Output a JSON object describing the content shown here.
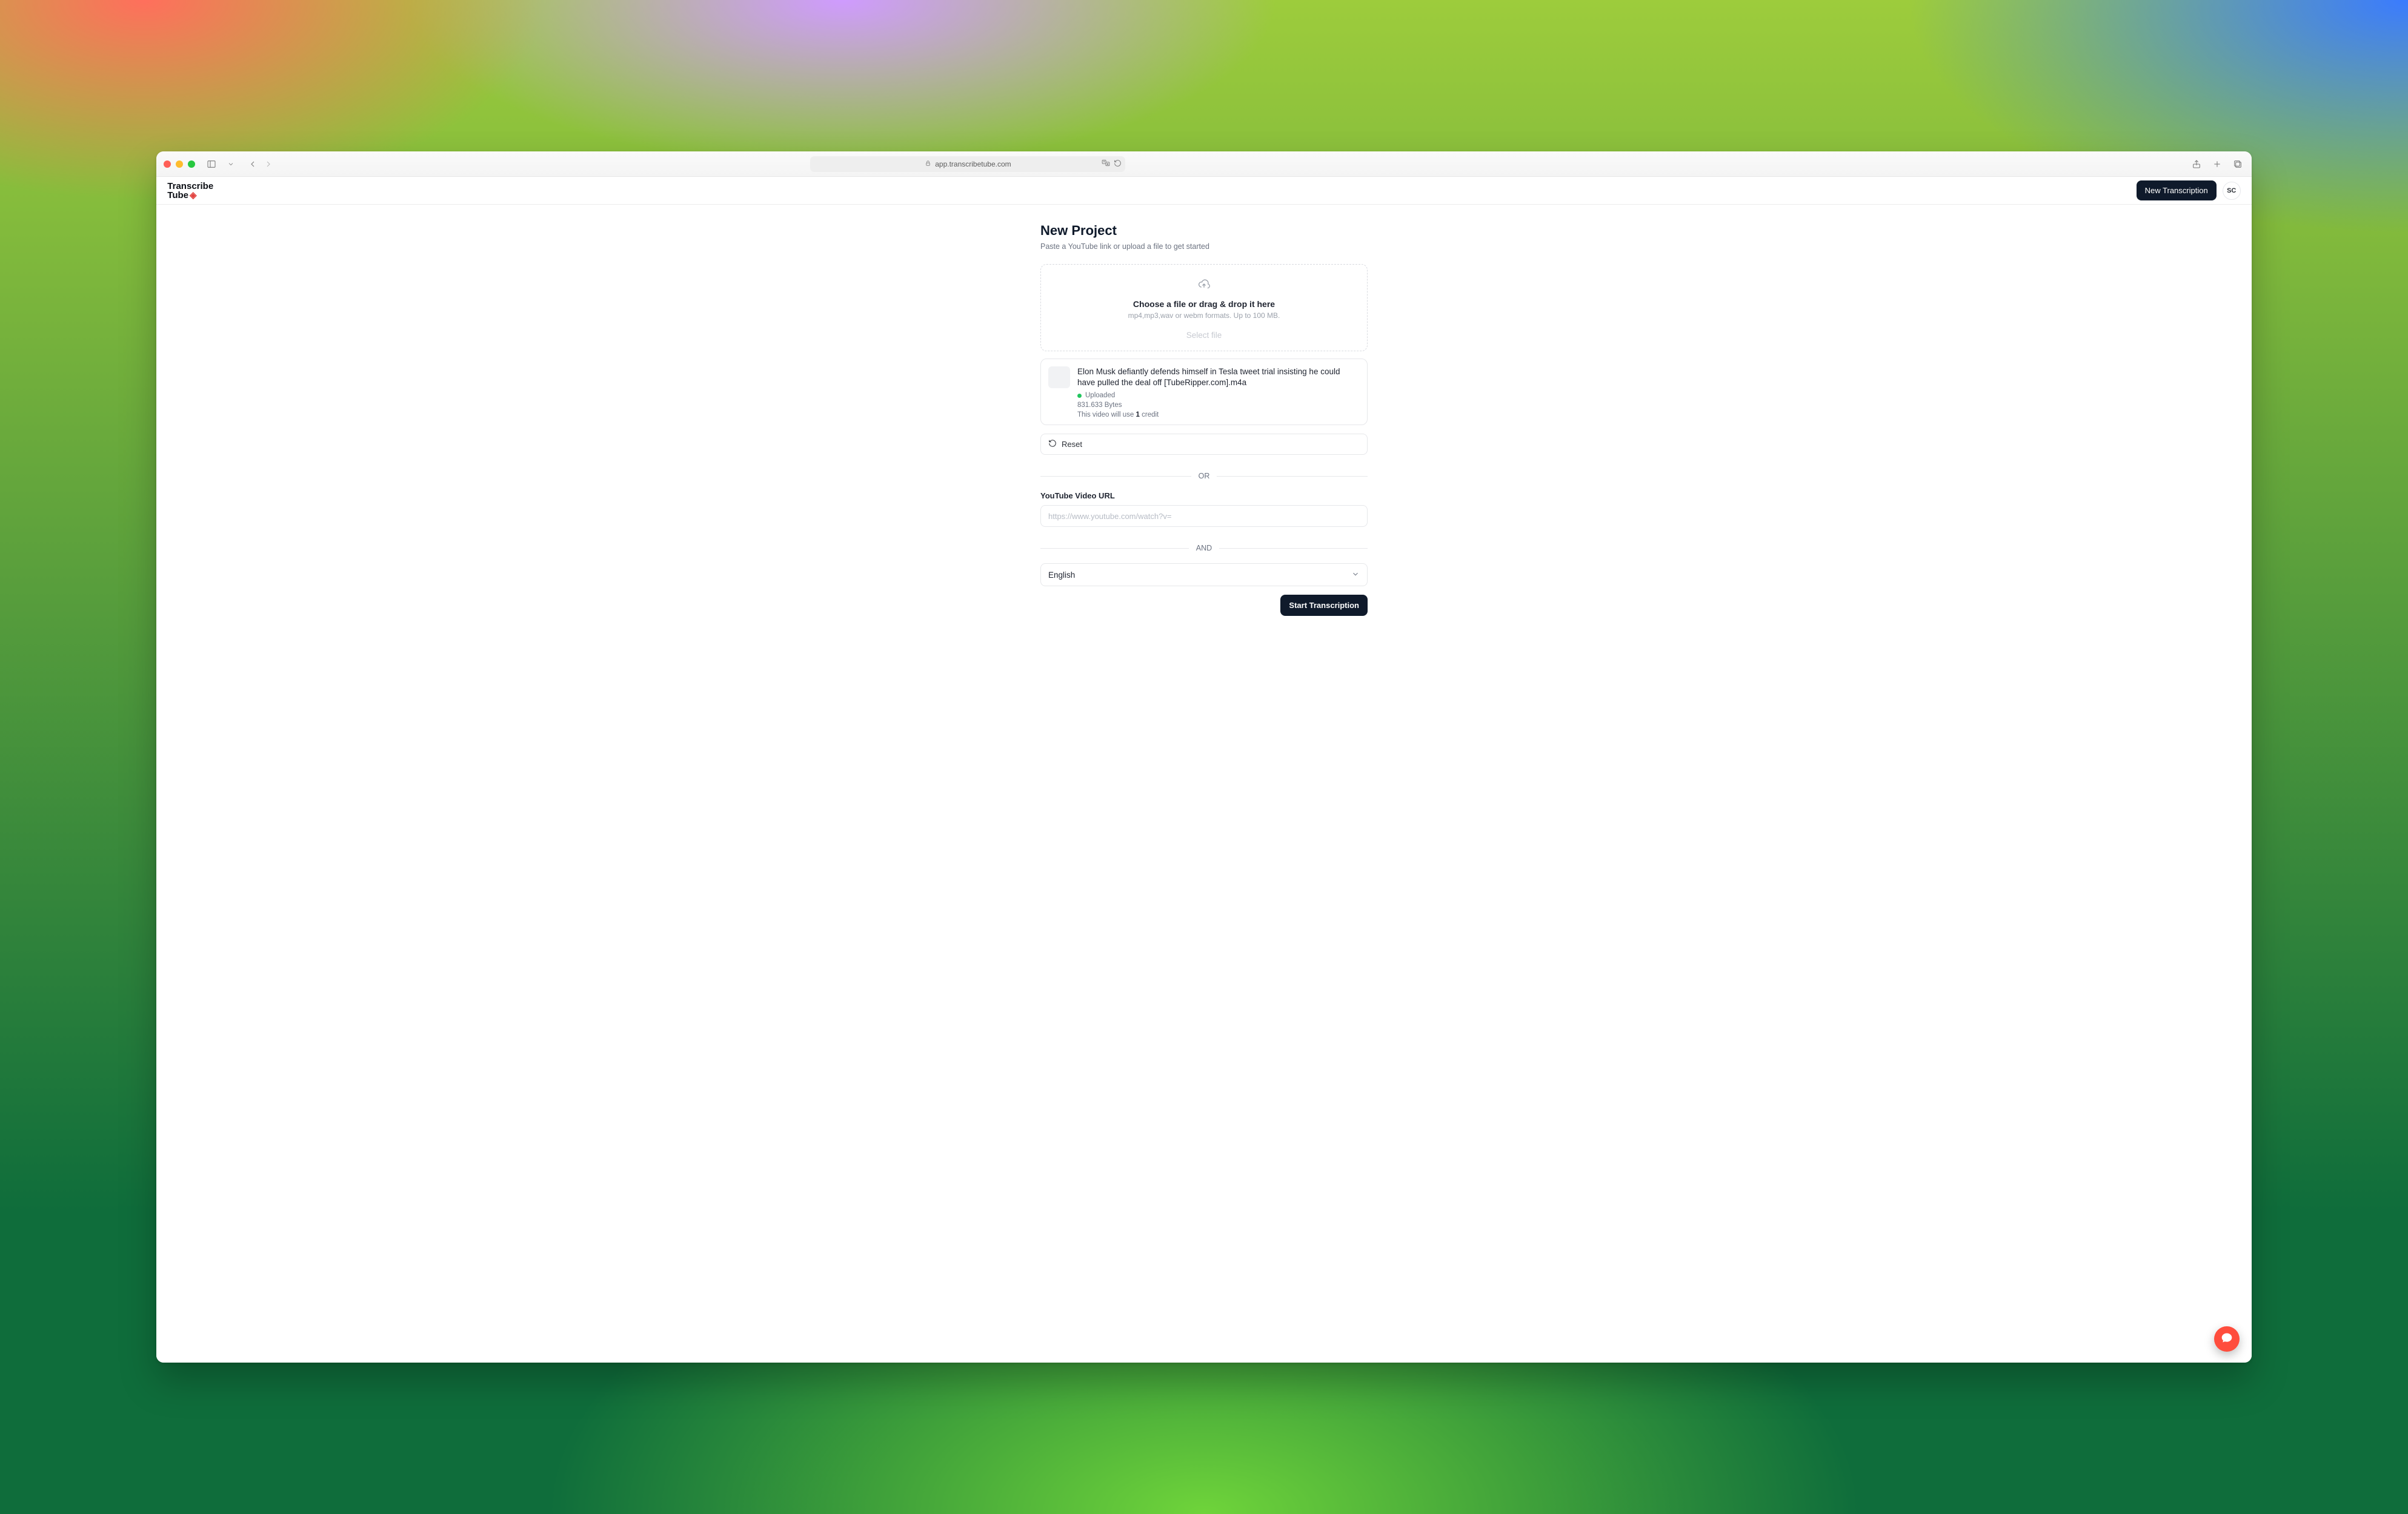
{
  "browser": {
    "address": "app.transcribetube.com"
  },
  "header": {
    "brand_line1": "Transcribe",
    "brand_line2": "Tube",
    "new_transcription_label": "New Transcription",
    "avatar_initials": "SC"
  },
  "page": {
    "title": "New Project",
    "subtitle": "Paste a YouTube link or upload a file to get started"
  },
  "dropzone": {
    "title": "Choose a file or drag & drop it here",
    "subtitle": "mp4,mp3,wav or webm formats. Up to 100 MB.",
    "select_label": "Select file"
  },
  "file": {
    "name": "Elon Musk defiantly defends himself in Tesla tweet trial insisting he could have pulled the deal off [TubeRipper.com].m4a",
    "status_label": "Uploaded",
    "size_text": "831.633 Bytes",
    "credit_prefix": "This video will use ",
    "credit_count": "1",
    "credit_suffix": " credit"
  },
  "reset": {
    "label": "Reset"
  },
  "dividers": {
    "or": "OR",
    "and": "AND"
  },
  "youtube": {
    "label": "YouTube Video URL",
    "placeholder": "https://www.youtube.com/watch?v="
  },
  "language": {
    "selected": "English"
  },
  "actions": {
    "start_label": "Start Transcription"
  }
}
